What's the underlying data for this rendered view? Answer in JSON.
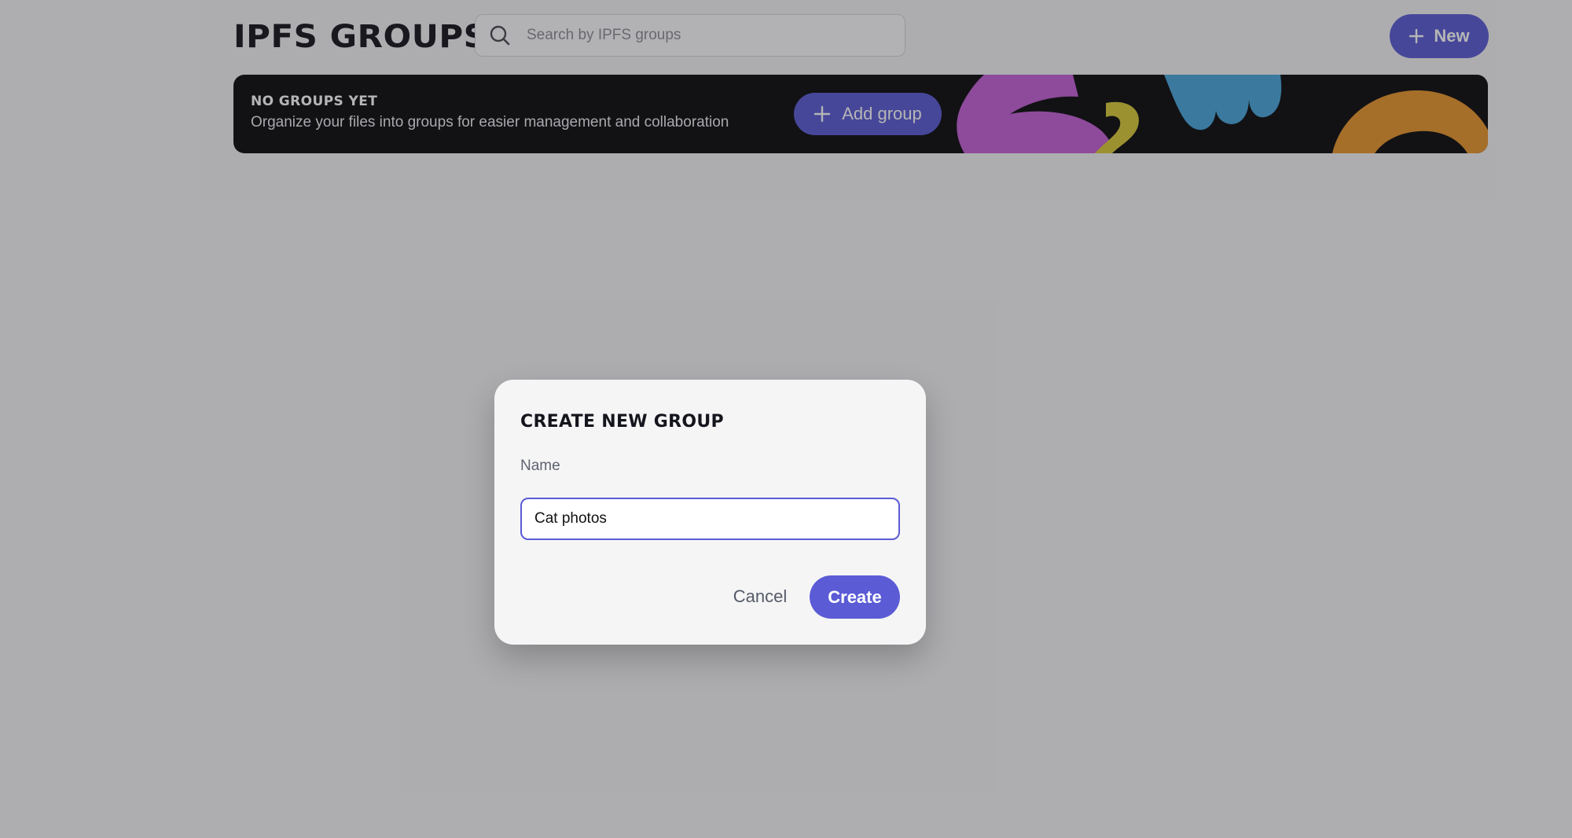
{
  "header": {
    "title": "IPFS GROUPS",
    "search_placeholder": "Search by IPFS groups",
    "search_icon": "search-icon",
    "new_button_label": "New",
    "new_button_icon": "plus-icon"
  },
  "banner": {
    "heading": "NO GROUPS YET",
    "subtext": "Organize your files into groups for easier management and collaboration",
    "add_button_label": "Add group",
    "add_button_icon": "plus-icon",
    "decor_colors": [
      "#c560d7",
      "#d8c93a",
      "#4aa6dc",
      "#e8952d"
    ]
  },
  "modal": {
    "title": "CREATE NEW GROUP",
    "name_label": "Name",
    "name_value": "Cat photos",
    "cancel_label": "Cancel",
    "create_label": "Create"
  },
  "colors": {
    "accent": "#5b5bd6",
    "banner_bg": "#0c0c10",
    "modal_bg": "#f5f5f6"
  }
}
